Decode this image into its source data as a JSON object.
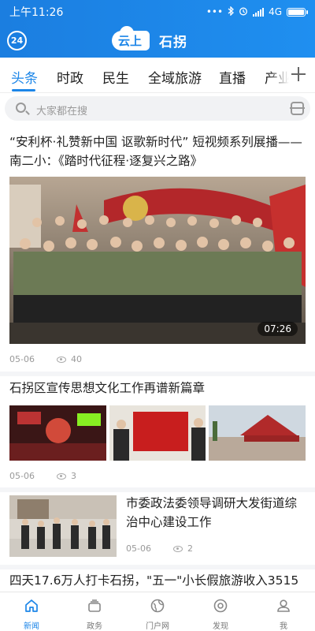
{
  "status_bar": {
    "time": "上午11:26",
    "network": "4G",
    "dots": "•••"
  },
  "header": {
    "clock_badge": "24",
    "brand_cloud": "云上",
    "brand_name": "石拐"
  },
  "tabs": [
    {
      "label": "头条",
      "active": true
    },
    {
      "label": "时政",
      "active": false
    },
    {
      "label": "民生",
      "active": false
    },
    {
      "label": "全域旅游",
      "active": false
    },
    {
      "label": "直播",
      "active": false
    },
    {
      "label": "产业",
      "active": false
    }
  ],
  "search": {
    "placeholder": "大家都在搜"
  },
  "feed": {
    "article1": {
      "title": "“安利杯·礼赞新中国 讴歌新时代” 短视频系列展播——南二小：《踏时代征程·逐复兴之路》",
      "duration": "07:26",
      "date": "05-06",
      "views": "40"
    },
    "article2": {
      "title": "石拐区宣传思想文化工作再谱新篇章",
      "date": "05-06",
      "views": "3"
    },
    "article3": {
      "title": "市委政法委领导调研大发街道综治中心建设工作",
      "date": "05-06",
      "views": "2"
    },
    "article4": {
      "title": "四天17.6万人打卡石拐，\"五一\"小长假旅游收入3515"
    }
  },
  "bottom_nav": [
    {
      "label": "新闻",
      "icon": "home-icon",
      "active": true
    },
    {
      "label": "政务",
      "icon": "stack-icon",
      "active": false
    },
    {
      "label": "门户网",
      "icon": "globe-icon",
      "active": false
    },
    {
      "label": "发现",
      "icon": "compass-icon",
      "active": false
    },
    {
      "label": "我",
      "icon": "user-icon",
      "active": false
    }
  ],
  "colors": {
    "primary": "#1d86e8",
    "background": "#ffffff",
    "muted": "#999999"
  }
}
